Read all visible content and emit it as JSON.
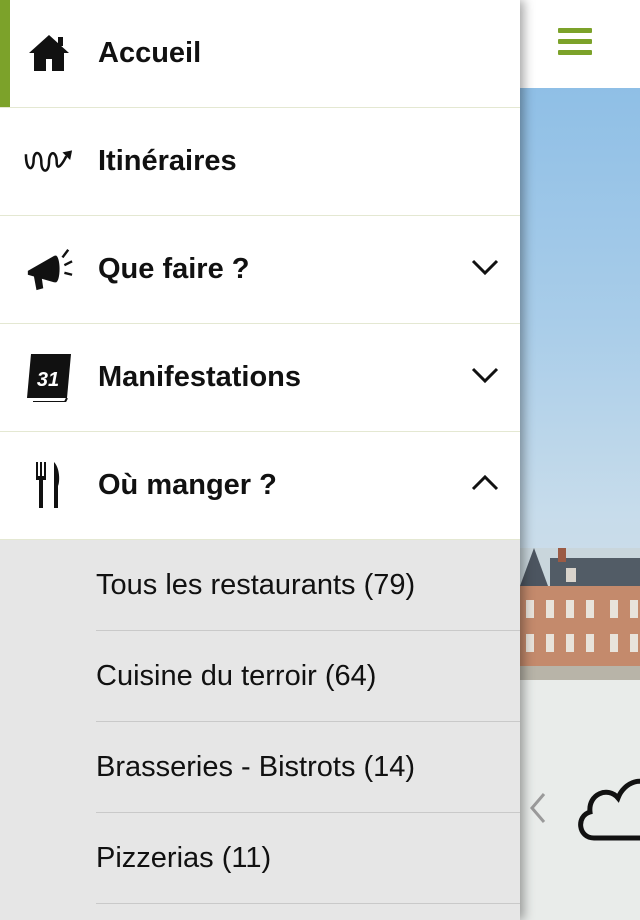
{
  "header": {
    "menu_icon": "hamburger-menu-icon",
    "accent_color": "#7ca22a"
  },
  "drawer": {
    "items": [
      {
        "label": "Accueil",
        "icon": "home-icon",
        "active": true
      },
      {
        "label": "Itinéraires",
        "icon": "route-icon"
      },
      {
        "label": "Que faire ?",
        "icon": "megaphone-icon",
        "expandable": true,
        "expanded": false
      },
      {
        "label": "Manifestations",
        "icon": "calendar-icon",
        "icon_text": "31",
        "expandable": true,
        "expanded": false
      },
      {
        "label": "Où manger ?",
        "icon": "fork-knife-icon",
        "expandable": true,
        "expanded": true
      }
    ],
    "submenu": [
      {
        "label": "Tous les restaurants (79)"
      },
      {
        "label": "Cuisine du terroir (64)"
      },
      {
        "label": "Brasseries - Bistrots (14)"
      },
      {
        "label": "Pizzerias (11)"
      }
    ]
  },
  "content": {
    "hero_image": "castle-photo",
    "weather_icon": "cloud-icon",
    "nav_icon": "chevron-left-icon"
  }
}
